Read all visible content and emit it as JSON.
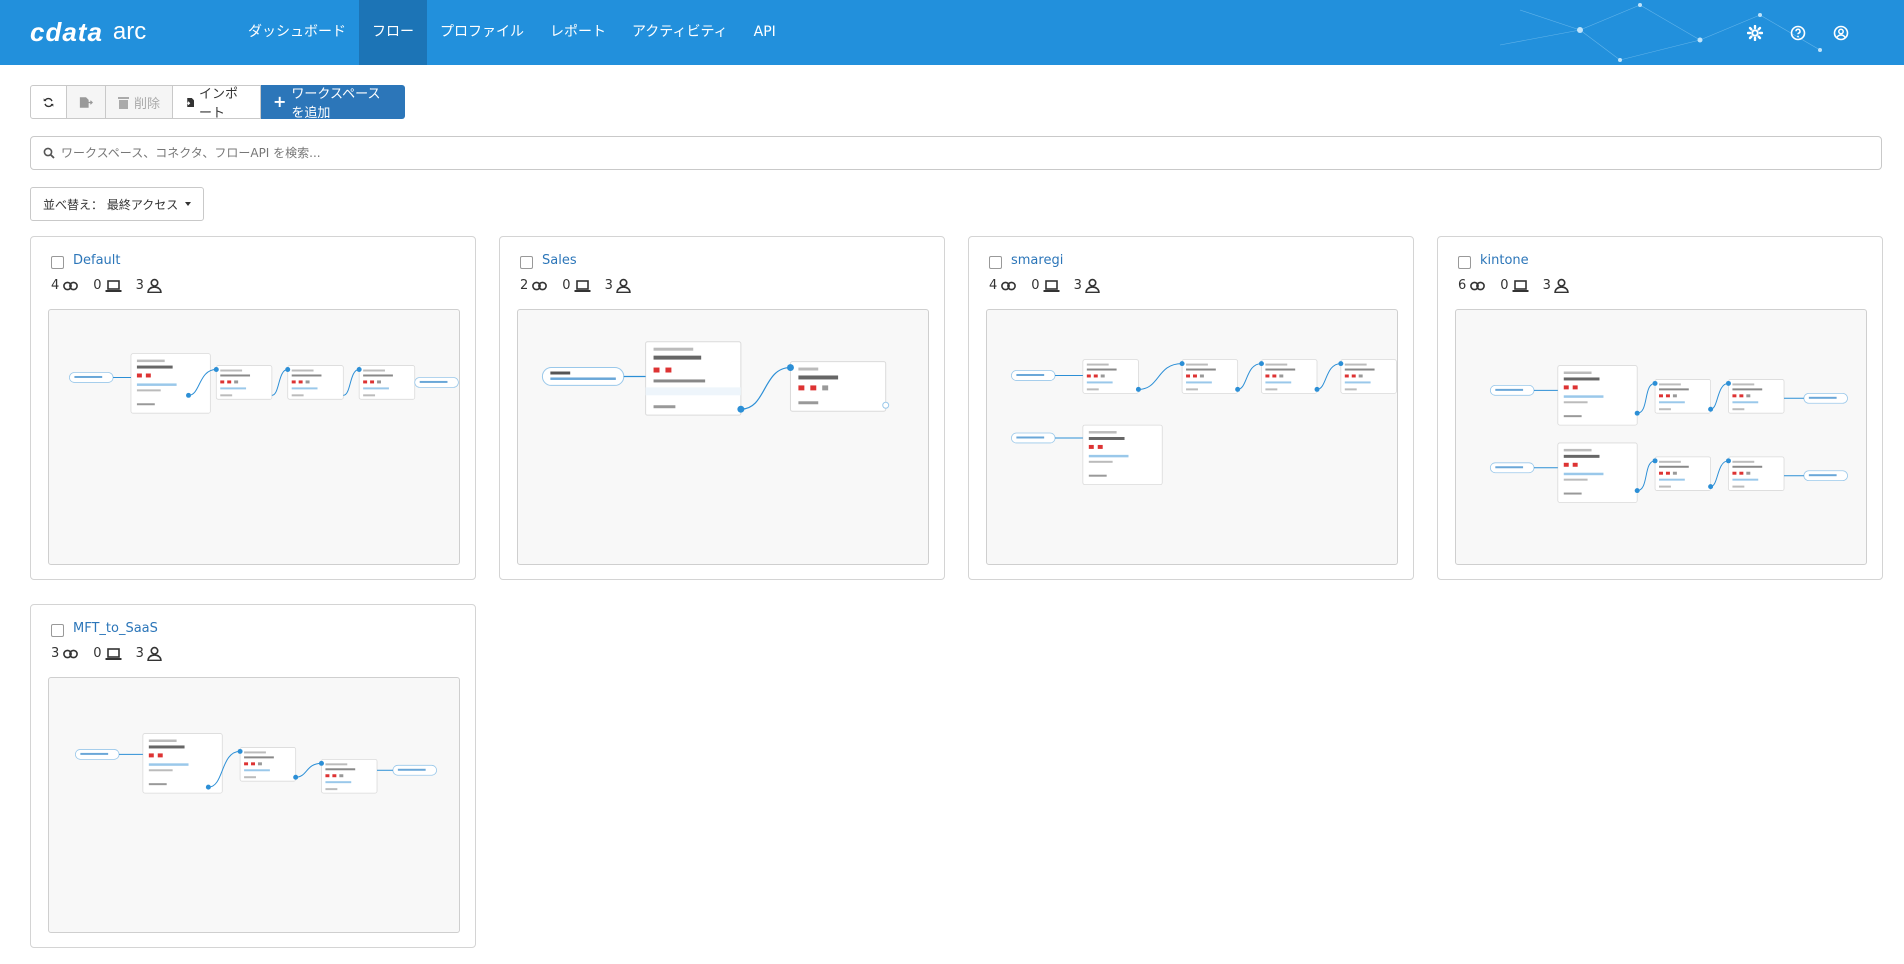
{
  "app": {
    "brand": "cdata",
    "product": "arc"
  },
  "nav": {
    "items": [
      {
        "label": "ダッシュボード",
        "active": false
      },
      {
        "label": "フロー",
        "active": true
      },
      {
        "label": "プロファイル",
        "active": false
      },
      {
        "label": "レポート",
        "active": false
      },
      {
        "label": "アクティビティ",
        "active": false
      },
      {
        "label": "API",
        "active": false
      }
    ],
    "icons": [
      "gear-icon",
      "help-icon",
      "user-icon"
    ]
  },
  "toolbar": {
    "refresh_icon": "refresh-icon",
    "export_icon": "export-icon",
    "delete_label": "削除",
    "import_label": "インポート",
    "add_label": "ワークスペースを追加"
  },
  "search": {
    "placeholder": "ワークスペース、コネクタ、フローAPI を検索..."
  },
  "sort": {
    "label": "並べ替え： 最終アクセス"
  },
  "workspaces": [
    {
      "name": "Default",
      "connectors": "4",
      "computers": "0",
      "users": "3"
    },
    {
      "name": "Sales",
      "connectors": "2",
      "computers": "0",
      "users": "3"
    },
    {
      "name": "smaregi",
      "connectors": "4",
      "computers": "0",
      "users": "3"
    },
    {
      "name": "kintone",
      "connectors": "6",
      "computers": "0",
      "users": "3"
    },
    {
      "name": "MFT_to_SaaS",
      "connectors": "3",
      "computers": "0",
      "users": "3"
    }
  ],
  "colors": {
    "header": "#2290dc",
    "header_active": "#1c74b6",
    "primary_button": "#2c76b9",
    "link": "#2c76b9"
  }
}
